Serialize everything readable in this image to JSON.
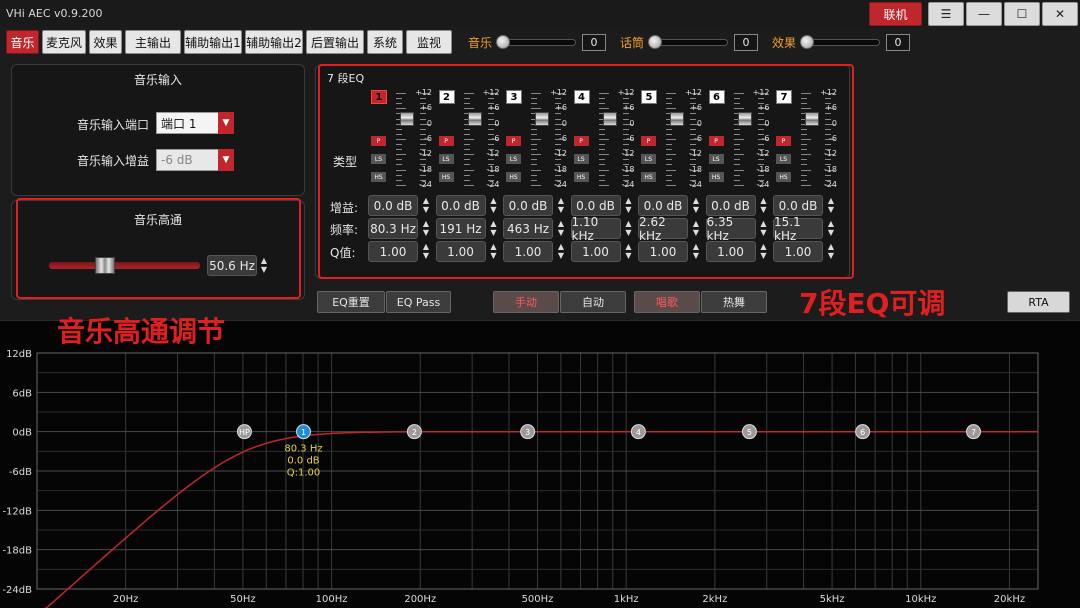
{
  "app": {
    "title": "VHi AEC v0.9.200",
    "connect_label": "联机"
  },
  "window_buttons": {
    "menu": "☰",
    "minimize": "—",
    "maximize": "☐",
    "close": "✕"
  },
  "menu": {
    "items": [
      "音乐",
      "麦克风",
      "效果",
      "主输出",
      "辅助输出1",
      "辅助输出2",
      "后置输出",
      "系统",
      "监视"
    ],
    "active_index": 0
  },
  "mix": [
    {
      "label": "音乐",
      "value": "0"
    },
    {
      "label": "话筒",
      "value": "0"
    },
    {
      "label": "效果",
      "value": "0"
    }
  ],
  "music_input": {
    "title": "音乐输入",
    "port_label": "音乐输入端口",
    "port_value": "端口 1",
    "gain_label": "音乐输入增益",
    "gain_value": "-6 dB"
  },
  "hpf": {
    "title": "音乐高通",
    "value": "50.6 Hz",
    "level": 0.36
  },
  "eq": {
    "title": "7 段EQ",
    "type_label": "类型",
    "gain_label": "增益:",
    "freq_label": "频率:",
    "q_label": "Q值:",
    "scale": [
      "+12",
      "+6",
      "0",
      "-6",
      "-12",
      "-18",
      "-24"
    ],
    "selected_band": 1,
    "bands": [
      {
        "num": "1",
        "gain": "0.0 dB",
        "freq": "80.3 Hz",
        "q": "1.00"
      },
      {
        "num": "2",
        "gain": "0.0 dB",
        "freq": "191 Hz",
        "q": "1.00"
      },
      {
        "num": "3",
        "gain": "0.0 dB",
        "freq": "463 Hz",
        "q": "1.00"
      },
      {
        "num": "4",
        "gain": "0.0 dB",
        "freq": "1.10 kHz",
        "q": "1.00"
      },
      {
        "num": "5",
        "gain": "0.0 dB",
        "freq": "2.62 kHz",
        "q": "1.00"
      },
      {
        "num": "6",
        "gain": "0.0 dB",
        "freq": "6.35 kHz",
        "q": "1.00"
      },
      {
        "num": "7",
        "gain": "0.0 dB",
        "freq": "15.1 kHz",
        "q": "1.00"
      }
    ],
    "type_buttons": {
      "p": "P",
      "ls": "LS",
      "hs": "HS"
    }
  },
  "buttons": {
    "eq_reset": "EQ重置",
    "eq_pass": "EQ Pass",
    "manual": "手动",
    "auto": "自动",
    "singing": "唱歌",
    "dance": "热舞",
    "rta": "RTA"
  },
  "annotations": {
    "hpf": "音乐高通调节",
    "eq": "7段EQ可调"
  },
  "graph": {
    "db_labels": [
      "12dB",
      "6dB",
      "0dB",
      "-6dB",
      "-12dB",
      "-18dB",
      "-24dB"
    ],
    "freq_labels": [
      "20Hz",
      "50Hz",
      "100Hz",
      "200Hz",
      "500Hz",
      "1kHz",
      "2kHz",
      "5kHz",
      "10kHz",
      "20kHz"
    ],
    "markers": [
      "HP",
      "1",
      "2",
      "3",
      "4",
      "5",
      "6",
      "7"
    ],
    "tooltip": [
      "80.3 Hz",
      "0.0 dB",
      "Q:1.00"
    ],
    "curve_color": "#c0272d",
    "selected_color": "#1e8fd6"
  }
}
